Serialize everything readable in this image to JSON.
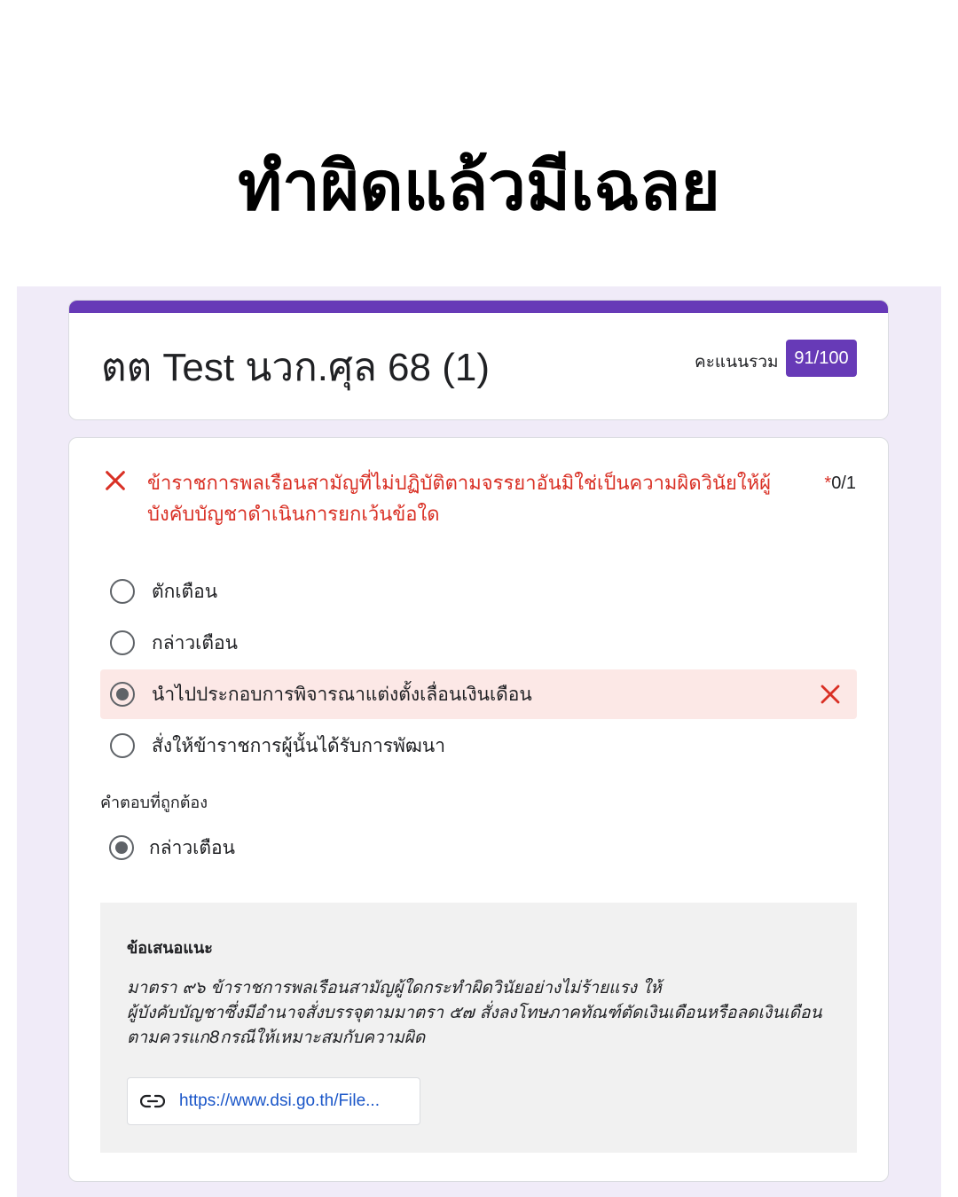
{
  "headline": "ทำผิดแล้วมีเฉลย",
  "colors": {
    "brand": "#673ab7",
    "form_background": "#f0ebf8",
    "error": "#d93025",
    "wrong_highlight": "#fce8e6",
    "link": "#1a56c8"
  },
  "form": {
    "title": "ตต Test นวก.ศุล 68 (1)",
    "score_label": "คะแนนรวม",
    "score": "91/100"
  },
  "question": {
    "status_icon": "close-icon",
    "text_line1": "ข้าราชการพลเรือนสามัญที่ไม่ปฏิบัติตามจรรยาอันมิใช่เป็นความผิดวินัยให้ผู้",
    "text_line2": "บังคับบัญชาดำเนินการยกเว้นข้อใด",
    "required_mark": "*",
    "points": "0/1",
    "options": [
      {
        "label": "ตักเตือน",
        "selected": false
      },
      {
        "label": "กล่าวเตือน",
        "selected": false
      },
      {
        "label": "นำไปประกอบการพิจารณาแต่งตั้งเลื่อนเงินเดือน",
        "selected": true,
        "wrong_icon": "close-icon"
      },
      {
        "label": "สั่งให้ข้าราชการผู้นั้นได้รับการพัฒนา",
        "selected": false
      }
    ],
    "correct_answer_label": "คำตอบที่ถูกต้อง",
    "correct_answer": "กล่าวเตือน",
    "feedback": {
      "title": "ข้อเสนอแนะ",
      "lines": [
        "มาตรา ๙๖ ข้าราชการพลเรือนสามัญผู้ใดกระทำผิดวินัยอย่างไม่ร้ายแรง ให้",
        "ผู้บังคับบัญชาซึ่งมีอำนาจสั่งบรรจุตามมาตรา ๕๗ สั่งลงโทษภาคทัณฑ์ตัดเงินเดือนหรือลดเงินเดือน",
        "ตามควรแก8กรณีให้เหมาะสมกับความผิด"
      ],
      "link_icon": "link-icon",
      "link_text": "https://www.dsi.go.th/File..."
    }
  }
}
